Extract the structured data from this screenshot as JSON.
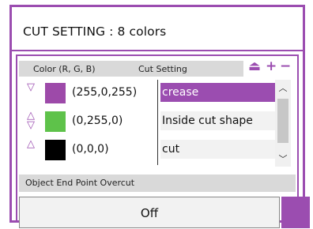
{
  "title": "CUT SETTING : 8 colors",
  "header": {
    "col_color": "Color (R, G, B)",
    "col_setting": "Cut Setting",
    "icons": [
      "eject-icon",
      "plus-icon",
      "minus-icon"
    ]
  },
  "rows": [
    {
      "rgb": "(255,0,255)",
      "setting": "crease",
      "color": "#9d4aa9",
      "selected": true,
      "arrows": "down"
    },
    {
      "rgb": "(0,255,0)",
      "setting": "Inside cut shape",
      "color": "#5ec24a",
      "selected": false,
      "arrows": "updown"
    },
    {
      "rgb": "(0,0,0)",
      "setting": "cut",
      "color": "#000000",
      "selected": false,
      "arrows": "up"
    }
  ],
  "overcut": {
    "label": "Object End Point Overcut",
    "value": "Off"
  },
  "colors": {
    "accent": "#9b4db0"
  }
}
